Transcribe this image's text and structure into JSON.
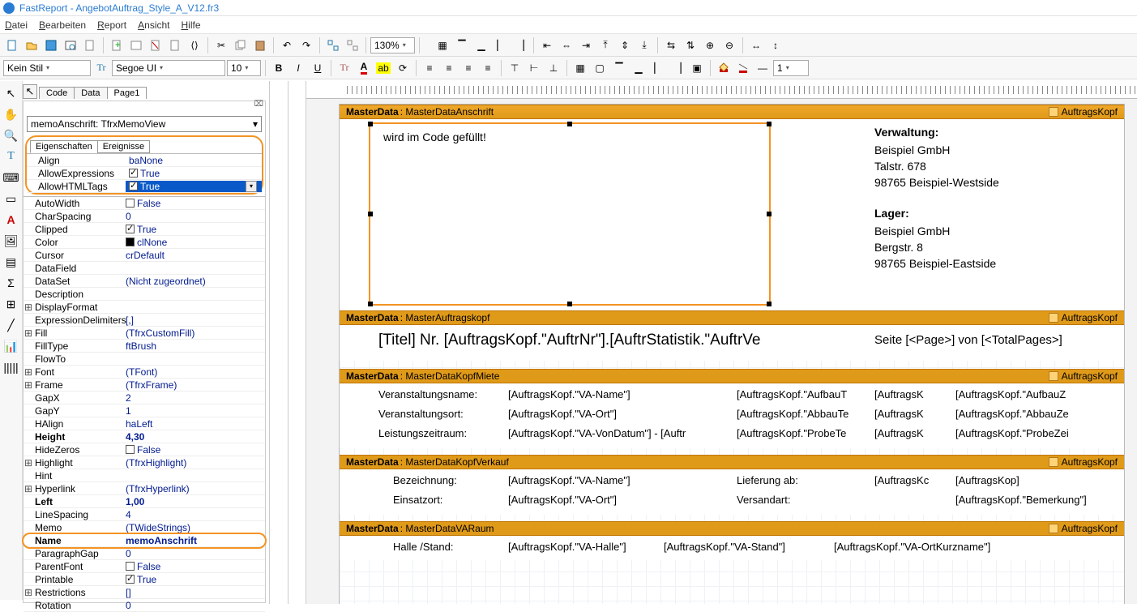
{
  "app": {
    "name": "FastReport",
    "document": "AngebotAuftrag_Style_A_V12.fr3"
  },
  "menu": [
    "Datei",
    "Bearbeiten",
    "Report",
    "Ansicht",
    "Hilfe"
  ],
  "toolbar": {
    "zoom": "130%"
  },
  "toolbar2": {
    "style": "Kein Stil",
    "font": "Segoe UI",
    "size": "10",
    "btnB": "B",
    "btnI": "I",
    "btnU": "U",
    "one": "1"
  },
  "pageTabs": {
    "code": "Code",
    "data": "Data",
    "page1": "Page1"
  },
  "inspector": {
    "objectCombo": "memoAnschrift: TfrxMemoView",
    "tabProps": "Eigenschaften",
    "tabEvents": "Ereignisse",
    "props": {
      "Align": "baNone",
      "AllowExpressions": "True",
      "AllowHTMLTags": "True",
      "AutoWidth": "False",
      "CharSpacing": "0",
      "Clipped": "True",
      "Color": "clNone",
      "Cursor": "crDefault",
      "DataField": "",
      "DataSet": "(Nicht zugeordnet)",
      "Description": "",
      "DisplayFormat": "",
      "ExpressionDelimiters": "[,]",
      "Fill": "(TfrxCustomFill)",
      "FillType": "ftBrush",
      "FlowTo": "",
      "Font": "(TFont)",
      "Frame": "(TfrxFrame)",
      "GapX": "2",
      "GapY": "1",
      "HAlign": "haLeft",
      "Height": "4,30",
      "HideZeros": "False",
      "Highlight": "(TfrxHighlight)",
      "Hint": "",
      "Hyperlink": "(TfrxHyperlink)",
      "Left": "1,00",
      "LineSpacing": "4",
      "Memo": "(TWideStrings)",
      "Name": "memoAnschrift",
      "ParagraphGap": "0",
      "ParentFont": "False",
      "Printable": "True",
      "Restrictions": "[]",
      "Rotation": "0"
    }
  },
  "canvas": {
    "band1": {
      "title": "MasterData",
      "data": "MasterDataAnschrift",
      "source": "AuftragsKopf",
      "memoText": "wird im Code gefüllt!",
      "addrTitle1": "Verwaltung:",
      "addr1a": "Beispiel GmbH",
      "addr1b": "Talstr. 678",
      "addr1c": "98765 Beispiel-Westside",
      "addrTitle2": "Lager:",
      "addr2a": "Beispiel GmbH",
      "addr2b": "Bergstr. 8",
      "addr2c": "98765 Beispiel-Eastside"
    },
    "band2": {
      "title": "MasterData",
      "data": "MasterAuftragskopf",
      "source": "AuftragsKopf",
      "titleField": "[Titel] Nr. [AuftragsKopf.\"AuftrNr\"].[AuftrStatistik.\"AuftrVe",
      "pageField": "Seite [<Page>] von [<TotalPages>]"
    },
    "band3": {
      "title": "MasterData",
      "data": "MasterDataKopfMiete",
      "source": "AuftragsKopf",
      "l1": "Veranstaltungsname:",
      "v1": "[AuftragsKopf.\"VA-Name\"]",
      "l2": "Veranstaltungsort:",
      "v2": "[AuftragsKopf.\"VA-Ort\"]",
      "l3": "Leistungszeitraum:",
      "v3": "[AuftragsKopf.\"VA-VonDatum\"] - [Auftr",
      "c1": "[AuftragsKopf.\"AufbauT",
      "c2": "[AuftragsKopf.\"AbbauTe",
      "c3": "[AuftragsKopf.\"ProbeTe",
      "d1": "[AuftragsK",
      "d2": "[AuftragsK",
      "d3": "[AuftragsK",
      "e1": "[AuftragsKopf.\"AufbauZ",
      "e2": "[AuftragsKopf.\"AbbauZe",
      "e3": "[AuftragsKopf.\"ProbeZei"
    },
    "band4": {
      "title": "MasterData",
      "data": "MasterDataKopfVerkauf",
      "source": "AuftragsKopf",
      "l1": "Bezeichnung:",
      "v1": "[AuftragsKopf.\"VA-Name\"]",
      "l2": "Einsatzort:",
      "v2": "[AuftragsKopf.\"VA-Ort\"]",
      "c1": "Lieferung ab:",
      "c2": "Versandart:",
      "d1": "[AuftragsKc",
      "d2": "",
      "e1": "[AuftragsKop]",
      "e2": "[AuftragsKopf.\"Bemerkung\"]"
    },
    "band5": {
      "title": "MasterData",
      "data": "MasterDataVARaum",
      "source": "AuftragsKopf",
      "l1": "Halle /Stand:",
      "v1": "[AuftragsKopf.\"VA-Halle\"]",
      "c1": "[AuftragsKopf.\"VA-Stand\"]",
      "e1": "[AuftragsKopf.\"VA-OrtKurzname\"]"
    }
  }
}
